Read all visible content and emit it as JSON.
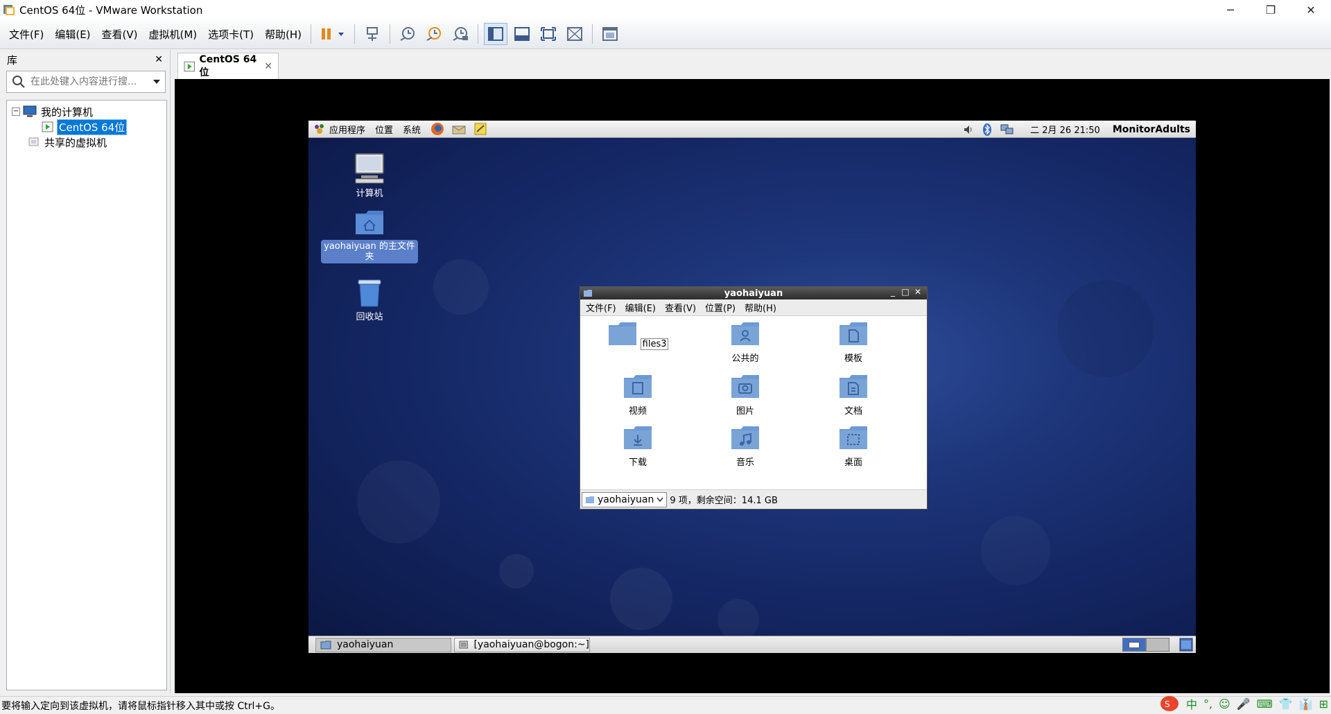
{
  "window": {
    "title": "CentOS 64位 - VMware Workstation",
    "controls": [
      "─",
      "❐",
      "✕"
    ]
  },
  "menubar": {
    "items": [
      "文件(F)",
      "编辑(E)",
      "查看(V)",
      "虚拟机(M)",
      "选项卡(T)",
      "帮助(H)"
    ]
  },
  "library": {
    "title": "库",
    "close": "✕",
    "search_placeholder": "在此处键入内容进行搜...",
    "tree": {
      "my_computer": "我的计算机",
      "vm": "CentOS 64位",
      "shared": "共享的虚拟机"
    }
  },
  "tab": {
    "label": "CentOS 64位",
    "close": "✕"
  },
  "guest": {
    "panel": {
      "menus": [
        "应用程序",
        "位置",
        "系统"
      ],
      "clock": "二 2月 26 21:50",
      "user": "MonitorAdults"
    },
    "desktop_icons": {
      "computer": "计算机",
      "home": "yaohaiyuan 的主文件夹",
      "trash": "回收站"
    },
    "file_manager": {
      "title": "yaohaiyuan",
      "menus": [
        "文件(F)",
        "编辑(E)",
        "查看(V)",
        "位置(P)",
        "帮助(H)"
      ],
      "items": [
        "files3",
        "公共的",
        "模板",
        "视频",
        "图片",
        "文档",
        "下载",
        "音乐",
        "桌面"
      ],
      "location": "yaohaiyuan",
      "status": "9 项，剩余空间：14.1 GB"
    },
    "taskbar": {
      "task1": "yaohaiyuan",
      "task2": "[yaohaiyuan@bogon:~]"
    }
  },
  "statusbar": {
    "text": "要将输入定向到该虚拟机，请将鼠标指针移入其中或按 Ctrl+G。"
  },
  "ime": {
    "items": [
      "中",
      "°,",
      "☺",
      "🎤",
      "⌨",
      "👕",
      "👔",
      "⊞"
    ]
  },
  "colors": {
    "accent": "#0078d7",
    "guest_bg": "#1d3579",
    "folder": "#7aa4d6"
  }
}
